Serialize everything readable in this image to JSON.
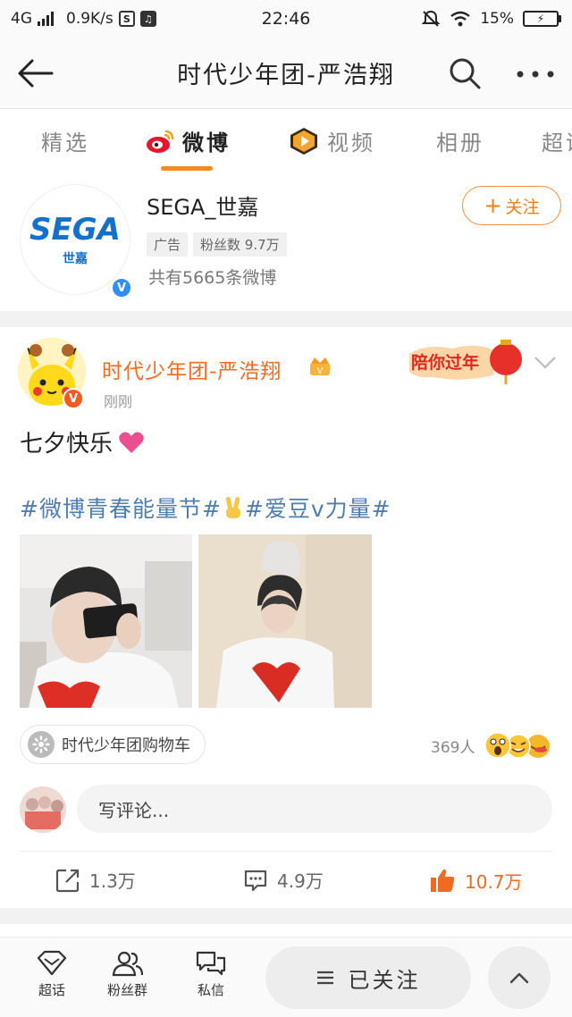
{
  "status_bar": {
    "network": "4G",
    "speed": "0.9K/s",
    "time": "22:46",
    "battery": "15%",
    "icons": [
      "signal-icon",
      "s-app-icon",
      "music-icon",
      "mute-icon",
      "wifi-icon",
      "battery-charging-icon"
    ]
  },
  "nav": {
    "title": "时代少年团-严浩翔",
    "icons": [
      "back-arrow-icon",
      "search-icon",
      "more-icon"
    ]
  },
  "tabs": {
    "items": [
      "精选",
      "微博",
      "视频",
      "相册",
      "超话"
    ],
    "active": "微博",
    "icons": [
      "weibo-logo-icon",
      "video-play-icon"
    ]
  },
  "account": {
    "logo_text": "SEGA",
    "logo_sub": "世嘉",
    "name": "SEGA_世嘉",
    "tag_ad": "广告",
    "tag_fans": "粉丝数 9.7万",
    "post_count": "共有5665条微博",
    "follow_label": "关注",
    "follow_symbol": "+"
  },
  "post": {
    "author": "时代少年团-严浩翔",
    "time": "刚刚",
    "sticker_text": "陪你过年",
    "text": "七夕快乐",
    "hashtag_1": "#微博青春能量节#",
    "hashtag_2": "#爱豆v力量#",
    "shop_label": "时代少年团购物车",
    "reaction_count": "369人",
    "comment_placeholder": "写评论...",
    "repost_count": "1.3万",
    "comment_count": "4.9万",
    "like_count": "10.7万",
    "accent_color": "#f46a1e",
    "hashtag_color": "#507daf"
  },
  "bottom_bar": {
    "items": [
      "超话",
      "粉丝群",
      "私信"
    ],
    "followed_label": "已关注"
  }
}
